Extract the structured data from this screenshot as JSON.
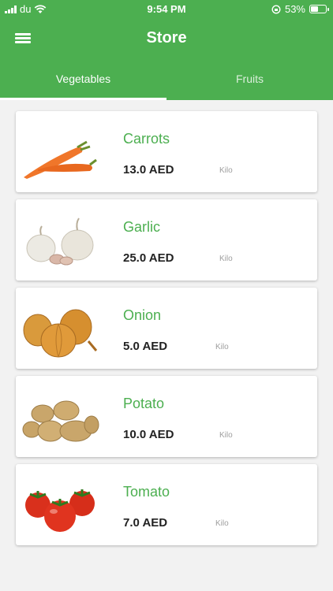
{
  "status_bar": {
    "carrier": "du",
    "time": "9:54 PM",
    "battery": "53%",
    "battery_level": 0.53
  },
  "header": {
    "title": "Store",
    "menu_icon": "hamburger-menu-icon"
  },
  "tabs": [
    {
      "label": "Vegetables",
      "active": true
    },
    {
      "label": "Fruits",
      "active": false
    }
  ],
  "products": [
    {
      "name": "Carrots",
      "price": "13.0 AED",
      "unit": "Kilo",
      "icon": "carrot-image"
    },
    {
      "name": "Garlic",
      "price": "25.0 AED",
      "unit": "Kilo",
      "icon": "garlic-image"
    },
    {
      "name": "Onion",
      "price": "5.0 AED",
      "unit": "Kilo",
      "icon": "onion-image"
    },
    {
      "name": "Potato",
      "price": "10.0 AED",
      "unit": "Kilo",
      "icon": "potato-image"
    },
    {
      "name": "Tomato",
      "price": "7.0 AED",
      "unit": "Kilo",
      "icon": "tomato-image"
    }
  ],
  "colors": {
    "primary": "#4caf50",
    "background": "#f2f2f2",
    "card": "#ffffff"
  }
}
